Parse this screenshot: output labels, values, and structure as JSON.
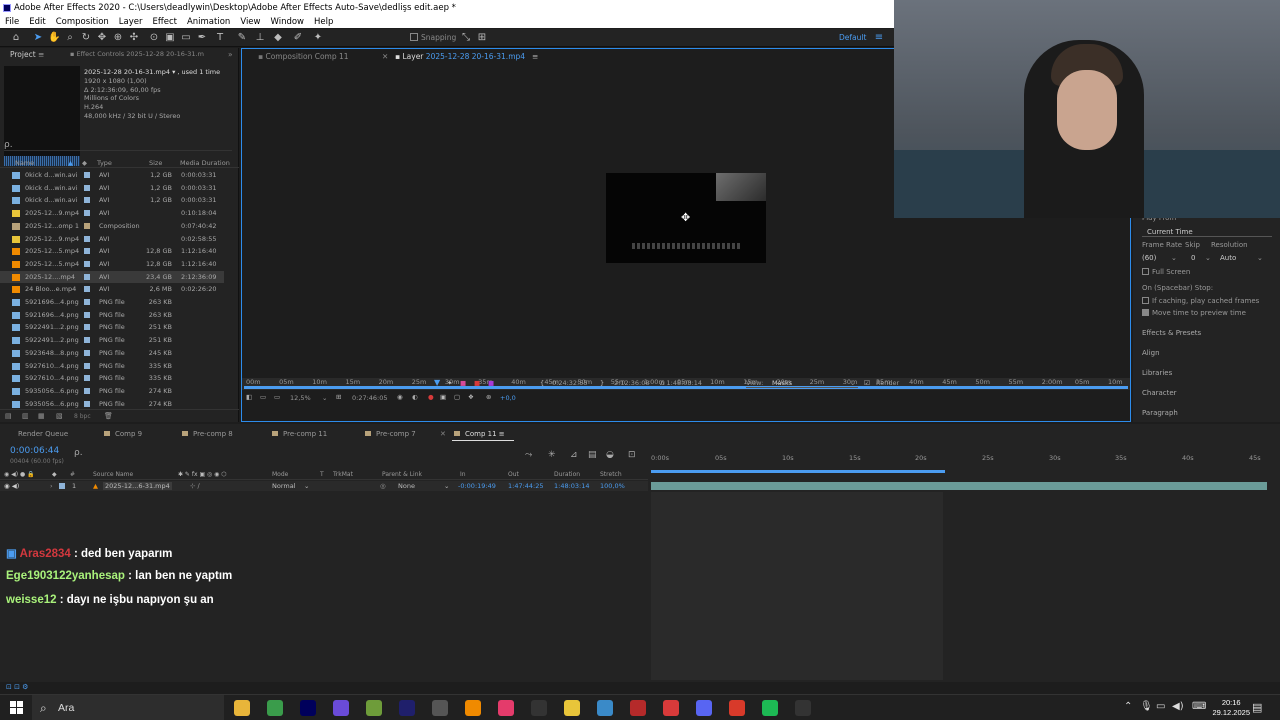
{
  "window": {
    "title": "Adobe After Effects 2020 - C:\\Users\\deadlywin\\Desktop\\Adobe After Effects Auto-Save\\dedlişs edit.aep *"
  },
  "menu": [
    "File",
    "Edit",
    "Composition",
    "Layer",
    "Effect",
    "Animation",
    "View",
    "Window",
    "Help"
  ],
  "toolbar": {
    "snapping": "Snapping",
    "workspace": "Default"
  },
  "project": {
    "tab": "Project",
    "effect_tab": "Effect Controls 2025-12-28 20-16-31.m",
    "file": {
      "name": "2025-12-28 20-16-31.mp4 ▾ , used 1 time",
      "info": [
        "1920 x 1080 (1,00)",
        "Δ 2:12:36:09, 60,00 fps",
        "Millions of Colors",
        "H.264",
        "48,000 kHz / 32 bit U / Stereo"
      ]
    },
    "search": "ρ.",
    "columns": [
      "Name",
      "Type",
      "Size",
      "Media Duration"
    ],
    "items": [
      {
        "name": "0kick d...win.avi",
        "type": "AVI",
        "size": "1,2 GB",
        "duration": "0:00:03:31",
        "icon": "avi-icon",
        "label": "#8fb4d8"
      },
      {
        "name": "0kick d...win.avi",
        "type": "AVI",
        "size": "1,2 GB",
        "duration": "0:00:03:31",
        "icon": "avi-icon",
        "label": "#8fb4d8"
      },
      {
        "name": "0kick d...win.avi",
        "type": "AVI",
        "size": "1,2 GB",
        "duration": "0:00:03:31",
        "icon": "avi-icon",
        "label": "#8fb4d8"
      },
      {
        "name": "2025-12...9.mp4",
        "type": "AVI",
        "size": "",
        "duration": "0:10:18:04",
        "icon": "video-icon",
        "label": "#8fb4d8"
      },
      {
        "name": "2025-12...omp 1",
        "type": "Composition",
        "size": "",
        "duration": "0:07:40:42",
        "icon": "composition-icon",
        "label": "#b8a27a"
      },
      {
        "name": "2025-12...9.mp4",
        "type": "AVI",
        "size": "",
        "duration": "0:02:58:55",
        "icon": "video-icon",
        "label": "#8fb4d8"
      },
      {
        "name": "2025-12...5.mp4",
        "type": "AVI",
        "size": "12,8 GB",
        "duration": "1:12:16:40",
        "icon": "vlc-icon",
        "label": "#8fb4d8"
      },
      {
        "name": "2025-12...5.mp4",
        "type": "AVI",
        "size": "12,8 GB",
        "duration": "1:12:16:40",
        "icon": "vlc-icon",
        "label": "#8fb4d8"
      },
      {
        "name": "2025-12....mp4",
        "type": "AVI",
        "size": "23,4 GB",
        "duration": "2:12:36:09",
        "icon": "vlc-icon",
        "label": "#8fb4d8",
        "selected": true
      },
      {
        "name": "24 Bloo...e.mp4",
        "type": "AVI",
        "size": "2,6 MB",
        "duration": "0:02:26:20",
        "icon": "vlc-icon",
        "label": "#8fb4d8"
      },
      {
        "name": "5921696...4.png",
        "type": "PNG file",
        "size": "263 KB",
        "duration": "",
        "icon": "png-icon",
        "label": "#8fb4d8"
      },
      {
        "name": "5921696...4.png",
        "type": "PNG file",
        "size": "263 KB",
        "duration": "",
        "icon": "png-icon",
        "label": "#8fb4d8"
      },
      {
        "name": "5922491...2.png",
        "type": "PNG file",
        "size": "251 KB",
        "duration": "",
        "icon": "png-icon",
        "label": "#8fb4d8"
      },
      {
        "name": "5922491...2.png",
        "type": "PNG file",
        "size": "251 KB",
        "duration": "",
        "icon": "png-icon",
        "label": "#8fb4d8"
      },
      {
        "name": "5923648...8.png",
        "type": "PNG file",
        "size": "245 KB",
        "duration": "",
        "icon": "png-icon",
        "label": "#8fb4d8"
      },
      {
        "name": "5927610...4.png",
        "type": "PNG file",
        "size": "335 KB",
        "duration": "",
        "icon": "png-icon",
        "label": "#8fb4d8"
      },
      {
        "name": "5927610...4.png",
        "type": "PNG file",
        "size": "335 KB",
        "duration": "",
        "icon": "png-icon",
        "label": "#8fb4d8"
      },
      {
        "name": "5935056...6.png",
        "type": "PNG file",
        "size": "274 KB",
        "duration": "",
        "icon": "png-icon",
        "label": "#8fb4d8"
      },
      {
        "name": "5935056...6.png",
        "type": "PNG file",
        "size": "274 KB",
        "duration": "",
        "icon": "png-icon",
        "label": "#8fb4d8"
      }
    ],
    "bpc": "8 bpc"
  },
  "viewer": {
    "tabs": [
      {
        "label": "Composition Comp 11",
        "active": false
      },
      {
        "label": "Layer",
        "suffix": "2025-12-28 20-16-31.mp4",
        "active": true
      }
    ],
    "ruler_ticks": [
      "00m",
      "05m",
      "10m",
      "15m",
      "20m",
      "25m",
      "30m",
      "35m",
      "40m",
      "45m",
      "50m",
      "55m",
      "1:00m",
      "05m",
      "10m",
      "15m",
      "20m",
      "25m",
      "30m",
      "35m",
      "40m",
      "45m",
      "50m",
      "55m",
      "2:00m",
      "05m",
      "10m"
    ],
    "controls": {
      "zoom": "12,5%",
      "time": "0:27:46:05",
      "in_point": "0:24:32:55",
      "out_point": "2:12:36:08",
      "duration": "Δ 1:48:03:14",
      "view_label": "View:",
      "view_value": "Masks",
      "render_label": "Render",
      "offset": "+0,0"
    }
  },
  "preview": {
    "play_from": "Play From",
    "current_time": "Current Time",
    "frame_rate_label": "Frame Rate",
    "skip_label": "Skip",
    "resolution_label": "Resolution",
    "frame_rate": "(60)",
    "skip": "0",
    "resolution": "Auto",
    "full_screen": "Full Screen",
    "spacebar_stop": "On (Spacebar) Stop:",
    "if_caching": "If caching, play cached frames",
    "move_time": "Move time to preview time",
    "sections": [
      "Effects & Presets",
      "Align",
      "Libraries",
      "Character",
      "Paragraph"
    ]
  },
  "timeline": {
    "tabs": [
      {
        "label": "Render Queue",
        "color": ""
      },
      {
        "label": "Comp 9",
        "color": "#b8a27a"
      },
      {
        "label": "Pre-comp 8",
        "color": "#b8a27a"
      },
      {
        "label": "Pre-comp 11",
        "color": "#b8a27a"
      },
      {
        "label": "Pre-comp 7",
        "color": "#b8a27a"
      },
      {
        "label": "Comp 11",
        "color": "#b8a27a",
        "active": true
      }
    ],
    "timecode": "0:00:06:44",
    "fps": "00404 (60.00 fps)",
    "columns": [
      "Source Name",
      "Mode",
      "T",
      "TrkMat",
      "Parent & Link",
      "In",
      "Out",
      "Duration",
      "Stretch"
    ],
    "layer": {
      "num": "1",
      "name": "2025-12...6-31.mp4",
      "mode": "Normal",
      "parent": "None",
      "in": "-0:00:19:49",
      "out": "1:47:44:25",
      "duration": "1:48:03:14",
      "stretch": "100,0%"
    },
    "ruler": [
      "0:00s",
      "05s",
      "10s",
      "15s",
      "20s",
      "25s",
      "30s",
      "35s",
      "40s",
      "45s"
    ]
  },
  "chat": [
    {
      "user": "Aras2834",
      "text": " : ded ben yaparım",
      "color": "#d3383e"
    },
    {
      "user": "Ege1903122yanhesap",
      "text": " : lan ben ne yaptım",
      "color": "#a9f27b"
    },
    {
      "user": "weisse12",
      "text": " : dayı ne işbu napıyon şu an",
      "color": "#a9f27b"
    }
  ],
  "taskbar": {
    "search": "Ara",
    "time": "20:16",
    "date": "29.12.2025",
    "apps": [
      {
        "name": "file-explorer-icon",
        "color": "#e8b53a"
      },
      {
        "name": "chrome-icon",
        "color": "#3a9c4b"
      },
      {
        "name": "after-effects-icon",
        "color": "#00005b"
      },
      {
        "name": "vpn-icon",
        "color": "#6a4bd8"
      },
      {
        "name": "minecraft-icon",
        "color": "#6e9c3a"
      },
      {
        "name": "media-encoder-icon",
        "color": "#1f1f6b"
      },
      {
        "name": "obs-icon",
        "color": "#555"
      },
      {
        "name": "vlc-icon",
        "color": "#f08a00"
      },
      {
        "name": "tiktok-icon",
        "color": "#e43b6b"
      },
      {
        "name": "app-icon",
        "color": "#333"
      },
      {
        "name": "maps-icon",
        "color": "#e8c53a"
      },
      {
        "name": "photo-icon",
        "color": "#3a8ac8"
      },
      {
        "name": "monitor-icon",
        "color": "#b52a2a"
      },
      {
        "name": "x-icon",
        "color": "#d83a3a"
      },
      {
        "name": "discord-icon",
        "color": "#5865f2"
      },
      {
        "name": "opera-icon",
        "color": "#d83a2a"
      },
      {
        "name": "spotify-icon",
        "color": "#1db954"
      },
      {
        "name": "github-icon",
        "color": "#333"
      }
    ]
  }
}
